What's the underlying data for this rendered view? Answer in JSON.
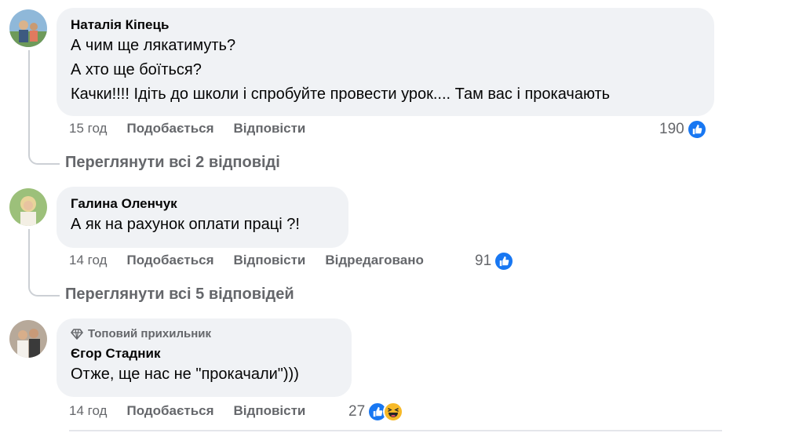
{
  "comments": [
    {
      "author": "Наталія Кіпець",
      "lines": [
        "А чим ще лякатимуть?",
        "А хто ще боїться?",
        "Качки!!!! Ідіть до школи і спробуйте провести урок.... Там вас і прокачають"
      ],
      "time": "15 год",
      "like_label": "Подобається",
      "reply_label": "Відповісти",
      "reaction_count": "190",
      "reactions": [
        "like-icon"
      ],
      "view_replies": "Переглянути всі 2 відповіді"
    },
    {
      "author": "Галина Оленчук",
      "lines": [
        "А як на рахунок оплати праці ?!"
      ],
      "time": "14 год",
      "like_label": "Подобається",
      "reply_label": "Відповісти",
      "edited_label": "Відредаговано",
      "reaction_count": "91",
      "reactions": [
        "like-icon"
      ],
      "view_replies": "Переглянути всі 5 відповідей"
    },
    {
      "badge": "Топовий прихильник",
      "badge_icon": "diamond-icon",
      "author": "Єгор Стадник",
      "lines": [
        "Отже, ще нас не \"прокачали\")))"
      ],
      "time": "14 год",
      "like_label": "Подобається",
      "reply_label": "Відповісти",
      "reaction_count": "27",
      "reactions": [
        "like-icon",
        "haha-icon"
      ]
    }
  ],
  "colors": {
    "bubble": "#f0f2f5",
    "secondary_text": "#65676b",
    "like_blue": "#1877f2",
    "haha_yellow": "#f7b928",
    "thread_line": "#ccd0d5"
  }
}
